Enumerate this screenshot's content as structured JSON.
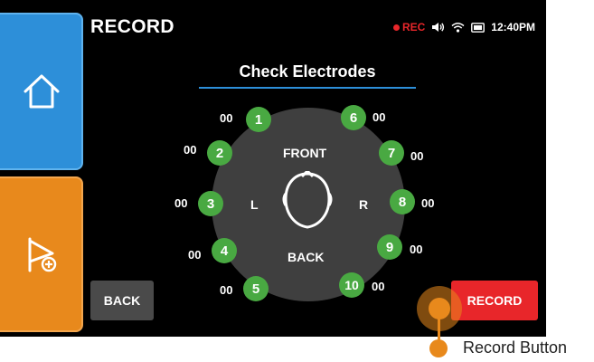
{
  "header": {
    "title": "RECORD"
  },
  "status_bar": {
    "rec_label": "REC",
    "time": "12:40PM"
  },
  "sidebar": {
    "home_icon": "home-icon",
    "flag_icon": "flag-plus-icon"
  },
  "panel": {
    "title": "Check Electrodes",
    "labels": {
      "front": "FRONT",
      "back": "BACK",
      "left": "L",
      "right": "R"
    }
  },
  "electrodes": [
    {
      "number": "1",
      "value": "00"
    },
    {
      "number": "2",
      "value": "00"
    },
    {
      "number": "3",
      "value": "00"
    },
    {
      "number": "4",
      "value": "00"
    },
    {
      "number": "5",
      "value": "00"
    },
    {
      "number": "6",
      "value": "00"
    },
    {
      "number": "7",
      "value": "00"
    },
    {
      "number": "8",
      "value": "00"
    },
    {
      "number": "9",
      "value": "00"
    },
    {
      "number": "10",
      "value": "00"
    }
  ],
  "buttons": {
    "back": "BACK",
    "record": "RECORD"
  },
  "annotation": {
    "label": "Record Button"
  },
  "colors": {
    "screen_bg": "#000000",
    "home_button": "#2d8fd9",
    "flag_button": "#e8891c",
    "electrode_ok": "#49a942",
    "record_button": "#e8262a",
    "rec_indicator": "#e8262a"
  }
}
